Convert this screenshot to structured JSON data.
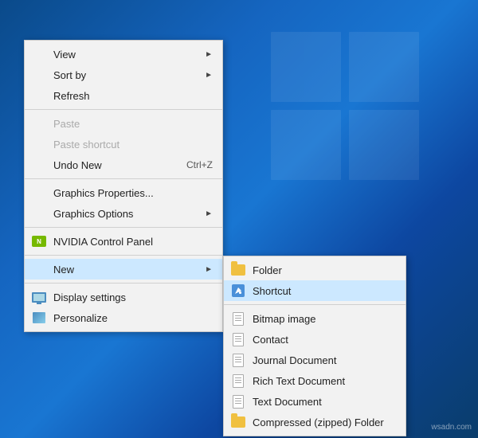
{
  "desktop": {
    "background": "#1565c0"
  },
  "context_menu": {
    "items": [
      {
        "id": "view",
        "label": "View",
        "arrow": true,
        "disabled": false,
        "icon": null
      },
      {
        "id": "sort-by",
        "label": "Sort by",
        "arrow": true,
        "disabled": false,
        "icon": null
      },
      {
        "id": "refresh",
        "label": "Refresh",
        "disabled": false,
        "icon": null
      },
      {
        "separator": true
      },
      {
        "id": "paste",
        "label": "Paste",
        "disabled": true,
        "icon": null
      },
      {
        "id": "paste-shortcut",
        "label": "Paste shortcut",
        "disabled": true,
        "icon": null
      },
      {
        "id": "undo-new",
        "label": "Undo New",
        "shortcut": "Ctrl+Z",
        "disabled": false,
        "icon": null
      },
      {
        "separator": true
      },
      {
        "id": "graphics-properties",
        "label": "Graphics Properties...",
        "disabled": false,
        "icon": null
      },
      {
        "id": "graphics-options",
        "label": "Graphics Options",
        "arrow": true,
        "disabled": false,
        "icon": null
      },
      {
        "separator": true
      },
      {
        "id": "nvidia",
        "label": "NVIDIA Control Panel",
        "disabled": false,
        "icon": "nvidia"
      },
      {
        "separator": true
      },
      {
        "id": "new",
        "label": "New",
        "arrow": true,
        "disabled": false,
        "icon": null,
        "hovered": true
      },
      {
        "separator": true
      },
      {
        "id": "display-settings",
        "label": "Display settings",
        "disabled": false,
        "icon": "display"
      },
      {
        "id": "personalize",
        "label": "Personalize",
        "disabled": false,
        "icon": "personalize"
      }
    ]
  },
  "submenu": {
    "items": [
      {
        "id": "folder",
        "label": "Folder",
        "icon": "folder"
      },
      {
        "id": "shortcut",
        "label": "Shortcut",
        "icon": "shortcut",
        "hovered": true
      },
      {
        "separator": true
      },
      {
        "id": "bitmap",
        "label": "Bitmap image",
        "icon": "doc"
      },
      {
        "id": "contact",
        "label": "Contact",
        "icon": "doc"
      },
      {
        "id": "journal",
        "label": "Journal Document",
        "icon": "doc"
      },
      {
        "id": "rich-text",
        "label": "Rich Text Document",
        "icon": "doc"
      },
      {
        "id": "text",
        "label": "Text Document",
        "icon": "doc"
      },
      {
        "id": "zip",
        "label": "Compressed (zipped) Folder",
        "icon": "folder"
      }
    ]
  },
  "watermark": "wsadn.com"
}
